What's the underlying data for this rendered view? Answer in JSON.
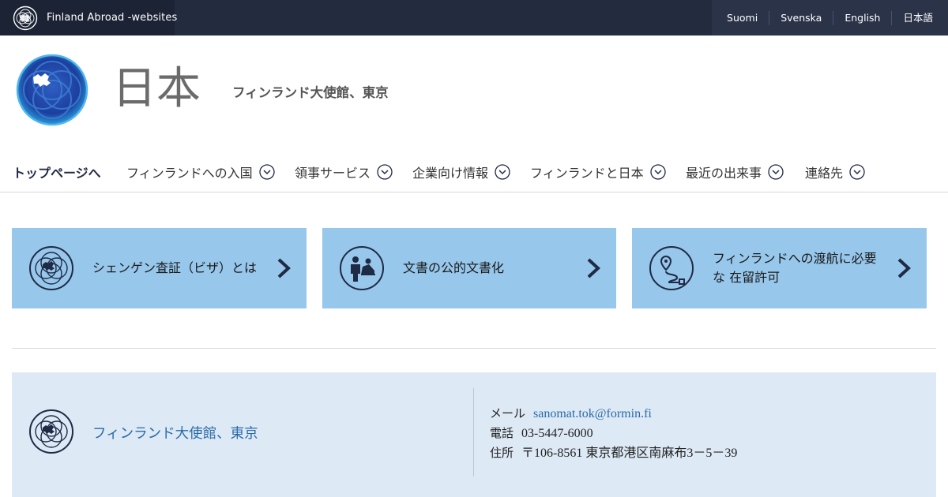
{
  "topbar": {
    "brand_text": "Finland Abroad -websites",
    "languages": [
      "Suomi",
      "Svenska",
      "English",
      "日本語"
    ]
  },
  "header": {
    "title": "日本",
    "subtitle": "フィンランド大使館、東京"
  },
  "nav": {
    "home": "トップページへ",
    "items": [
      "フィンランドへの入国",
      "領事サービス",
      "企業向け情報",
      "フィンランドと日本",
      "最近の出来事",
      "連絡先"
    ]
  },
  "cards": [
    {
      "text": "シェンゲン査証（ビザ）とは",
      "icon": "schengen-globe-icon"
    },
    {
      "text": "文書の公的文書化",
      "icon": "document-legalization-icon"
    },
    {
      "text": "フィンランドへの渡航に必要な 在留許可",
      "icon": "travel-route-icon"
    }
  ],
  "footer": {
    "name": "フィンランド大使館、東京",
    "email_label": "メール",
    "email": "sanomat.tok@formin.fi",
    "phone_label": "電話",
    "phone": "03-5447-6000",
    "address_label": "住所",
    "address": "〒106-8561 東京都港区南麻布3－5－39"
  },
  "colors": {
    "topbar": "#232b3e",
    "card": "#97c7eb",
    "footer": "#dde9f5",
    "navy": "#1f2a44",
    "link": "#2a6aa8"
  }
}
